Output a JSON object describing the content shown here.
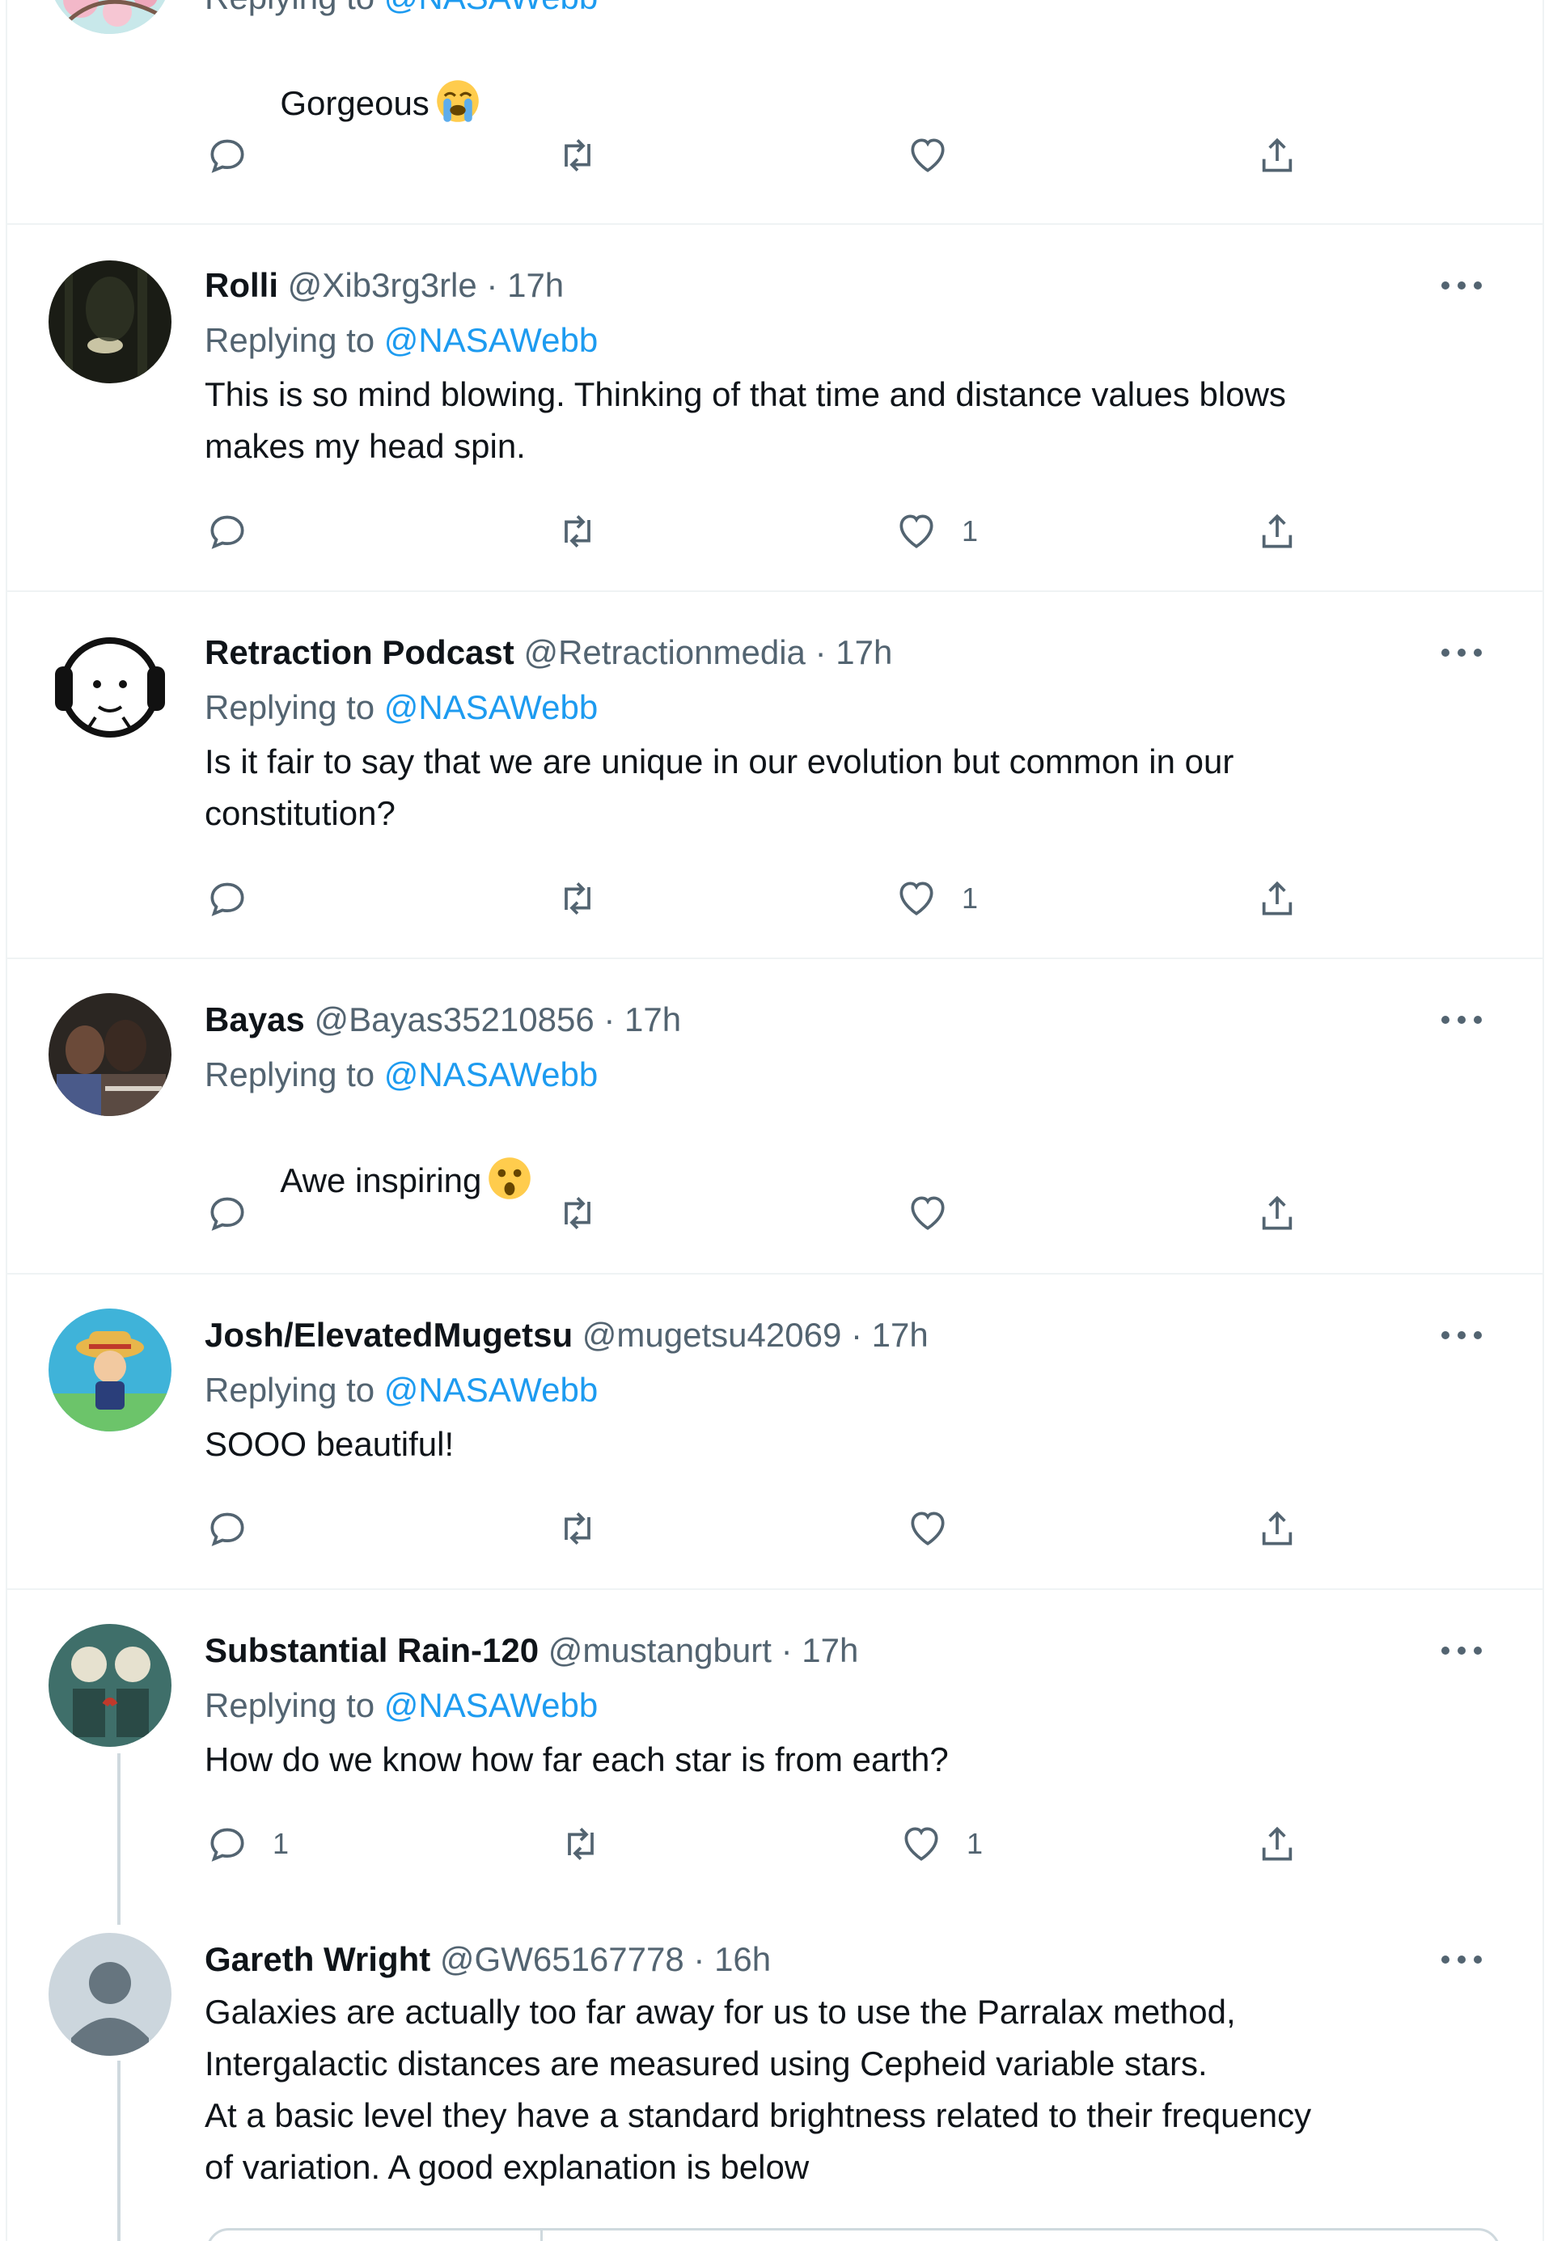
{
  "colors": {
    "text_primary": "#0f1419",
    "text_secondary": "#536471",
    "link": "#1d9bf0",
    "divider": "#eff3f4",
    "thread_line": "#cfd9de"
  },
  "tweets": [
    {
      "display_name": "",
      "handle": "",
      "time": "",
      "replying_prefix": "Replying to",
      "replying_to": "@NASAWebb",
      "text": "Gorgeous",
      "emoji": "loudly-crying-face",
      "replies": "",
      "retweets": "",
      "likes": ""
    },
    {
      "display_name": "Rolli",
      "handle": "@Xib3rg3rle",
      "time": "17h",
      "replying_prefix": "Replying to",
      "replying_to": "@NASAWebb",
      "text": "This is so mind blowing. Thinking of that time and distance values blows\nmakes my head spin.",
      "replies": "",
      "retweets": "",
      "likes": "1"
    },
    {
      "display_name": "Retraction Podcast",
      "handle": "@Retractionmedia",
      "time": "17h",
      "replying_prefix": "Replying to",
      "replying_to": "@NASAWebb",
      "text": "Is it fair to say that we are unique in our evolution but common in our\nconstitution?",
      "replies": "",
      "retweets": "",
      "likes": "1"
    },
    {
      "display_name": "Bayas",
      "handle": "@Bayas35210856",
      "time": "17h",
      "replying_prefix": "Replying to",
      "replying_to": "@NASAWebb",
      "text": "Awe inspiring",
      "emoji": "astonished-face",
      "replies": "",
      "retweets": "",
      "likes": ""
    },
    {
      "display_name": "Josh/ElevatedMugetsu",
      "handle": "@mugetsu42069",
      "time": "17h",
      "replying_prefix": "Replying to",
      "replying_to": "@NASAWebb",
      "text": "SOOO beautiful!",
      "replies": "",
      "retweets": "",
      "likes": ""
    },
    {
      "display_name": "Substantial Rain-120",
      "handle": "@mustangburt",
      "time": "17h",
      "replying_prefix": "Replying to",
      "replying_to": "@NASAWebb",
      "text": "How do we know how far each star is from earth?",
      "replies": "1",
      "retweets": "",
      "likes": "1"
    },
    {
      "display_name": "Gareth Wright",
      "handle": "@GW65167778",
      "time": "16h",
      "text": "Galaxies are actually too far away for us to use the Parralax method,\nIntergalactic distances are measured using Cepheid variable stars.\nAt a basic level they have a standard brightness related to their frequency\nof variation. A good explanation is below"
    }
  ],
  "separator": "·",
  "icons": {
    "reply": "reply-bubble-icon",
    "retweet": "retweet-icon",
    "like": "heart-icon",
    "share": "share-upload-icon",
    "more": "more-dots-icon"
  }
}
